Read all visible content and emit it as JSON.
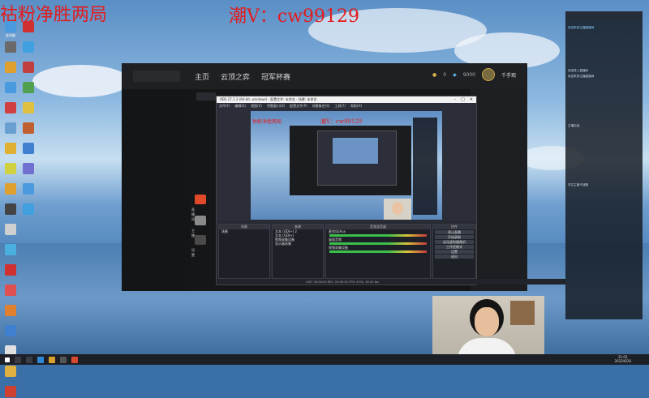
{
  "watermark": {
    "left": "祜粉净胜两局",
    "right": "潮V：cw99129"
  },
  "desktop_icons": [
    {
      "label": "此电脑",
      "color": "#4a9ae0"
    },
    {
      "label": "",
      "color": "#6a6a6a"
    },
    {
      "label": "",
      "color": "#e0a030"
    },
    {
      "label": "",
      "color": "#4a9ae0"
    },
    {
      "label": "",
      "color": "#d04040"
    },
    {
      "label": "",
      "color": "#6aa0d0"
    },
    {
      "label": "",
      "color": "#e0b030"
    },
    {
      "label": "",
      "color": "#d0d040"
    },
    {
      "label": "",
      "color": "#e0a030"
    },
    {
      "label": "",
      "color": "#444"
    },
    {
      "label": "",
      "color": "#d03030"
    },
    {
      "label": "",
      "color": "#40a0e0"
    },
    {
      "label": "",
      "color": "#c04040"
    },
    {
      "label": "",
      "color": "#50a050"
    },
    {
      "label": "",
      "color": "#e0c040"
    },
    {
      "label": "",
      "color": "#c06030"
    },
    {
      "label": "",
      "color": "#4080d0"
    },
    {
      "label": "",
      "color": "#7070d0"
    },
    {
      "label": "",
      "color": "#4a9ae0"
    },
    {
      "label": "",
      "color": "#40a0e0"
    },
    {
      "label": "",
      "color": "#d0d0d0"
    },
    {
      "label": "",
      "color": "#4ab0e0"
    },
    {
      "label": "",
      "color": "#d03030"
    },
    {
      "label": "",
      "color": "#e05050"
    },
    {
      "label": "",
      "color": "#e08030"
    },
    {
      "label": "",
      "color": "#4080d0"
    },
    {
      "label": "",
      "color": "#e0e0e0"
    },
    {
      "label": "",
      "color": "#e0b040"
    },
    {
      "label": "",
      "color": "#d04030"
    }
  ],
  "client": {
    "nav": [
      "主页",
      "云顶之弈",
      "冠军杯赛"
    ],
    "stats": [
      "0",
      "9000"
    ],
    "username": "千手观",
    "side_labels": [
      "直播间",
      "主播",
      "设置"
    ]
  },
  "obs": {
    "title": "OBS 27.1.3 (64-bit, windows) - 配置文件: 未命名 - 场景: 未命名",
    "menu": [
      "文件(F)",
      "编辑(E)",
      "视图(V)",
      "停靠窗口(D)",
      "配置文件(P)",
      "场景集合(S)",
      "工具(T)",
      "帮助(H)"
    ],
    "preview_watermark": "潮V：cw99129",
    "docks": {
      "scenes": {
        "header": "场景",
        "items": [
          "场景"
        ]
      },
      "sources": {
        "header": "来源",
        "items": [
          "文本 (GDI+) 2",
          "文本 (GDI+)",
          "视频采集设备",
          "显示器采集"
        ]
      },
      "mixer": {
        "header": "音频混音器",
        "items": [
          "麦克风/Aux",
          "桌面音频",
          "视频采集设备"
        ]
      },
      "transitions": {
        "header": "转场特效"
      },
      "controls": {
        "header": "控件",
        "items": [
          "停止直播",
          "开始录制",
          "启动虚拟摄像机",
          "工作室模式",
          "设置",
          "退出"
        ]
      }
    },
    "status": "LIVE: 00:00:00   REC: 00:00:00   CPU: 6.5%, 60.00 fps"
  },
  "chat_lines": [
    "欢迎来到主播直播间",
    "",
    "",
    "",
    "",
    "欢迎进入直播间",
    "欢迎来到主播直播间",
    "",
    "",
    "",
    "主播加油",
    "",
    "",
    "",
    "",
    "关注主播不迷路"
  ],
  "taskbar": {
    "time": "21:02",
    "date": "2022/6/26"
  }
}
